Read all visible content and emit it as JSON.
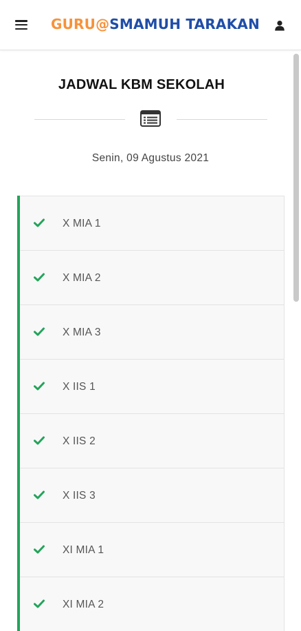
{
  "header": {
    "brand_part1": "GURU@",
    "brand_part2": "SMAMUH TARAKAN",
    "menu_icon": "hamburger-menu-icon",
    "user_icon": "user-icon"
  },
  "colors": {
    "brand_orange": "#f7923a",
    "brand_blue": "#1f4ea8",
    "accent_green": "#22a45a"
  },
  "main": {
    "title": "JADWAL KBM SEKOLAH",
    "divider_icon": "schedule-list-icon",
    "date": "Senin, 09 Agustus 2021"
  },
  "classes": [
    {
      "label": "X MIA 1",
      "icon": "check-icon"
    },
    {
      "label": "X MIA 2",
      "icon": "check-icon"
    },
    {
      "label": "X MIA 3",
      "icon": "check-icon"
    },
    {
      "label": "X IIS 1",
      "icon": "check-icon"
    },
    {
      "label": "X IIS 2",
      "icon": "check-icon"
    },
    {
      "label": "X IIS 3",
      "icon": "check-icon"
    },
    {
      "label": "XI MIA 1",
      "icon": "check-icon"
    },
    {
      "label": "XI MIA 2",
      "icon": "check-icon"
    }
  ]
}
